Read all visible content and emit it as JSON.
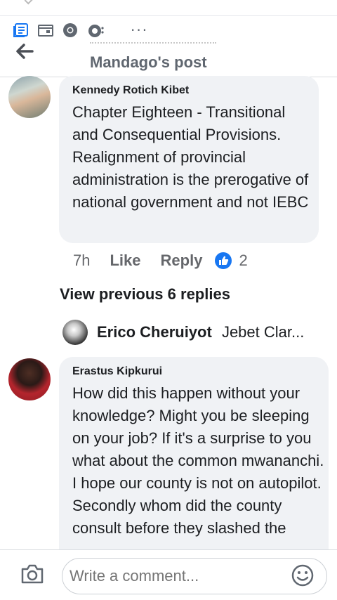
{
  "header": {
    "title": "Mandago's post"
  },
  "comments": [
    {
      "author": "Kennedy Rotich Kibet",
      "text": "Chapter Eighteen - Transitional and Consequential Provisions. Realignment of provincial administration is the prerogative of national government and not IEBC",
      "time": "7h",
      "like_label": "Like",
      "reply_label": "Reply",
      "reaction_count": "2"
    },
    {
      "author": "Erastus Kipkurui",
      "text": "How did this happen without your knowledge? Might you be sleeping on your job? If it's a surprise to you what about the common mwananchi. I hope our county is not on autopilot. Secondly whom did the county consult before they slashed the"
    }
  ],
  "view_previous": "View previous 6 replies",
  "collapsed_reply": {
    "name": "Erico Cheruiyot",
    "snippet": "Jebet Clar..."
  },
  "composer": {
    "placeholder": "Write a comment..."
  },
  "colors": {
    "accent": "#1877f2",
    "bubble": "#f0f2f5",
    "secondary_text": "#65676b"
  }
}
